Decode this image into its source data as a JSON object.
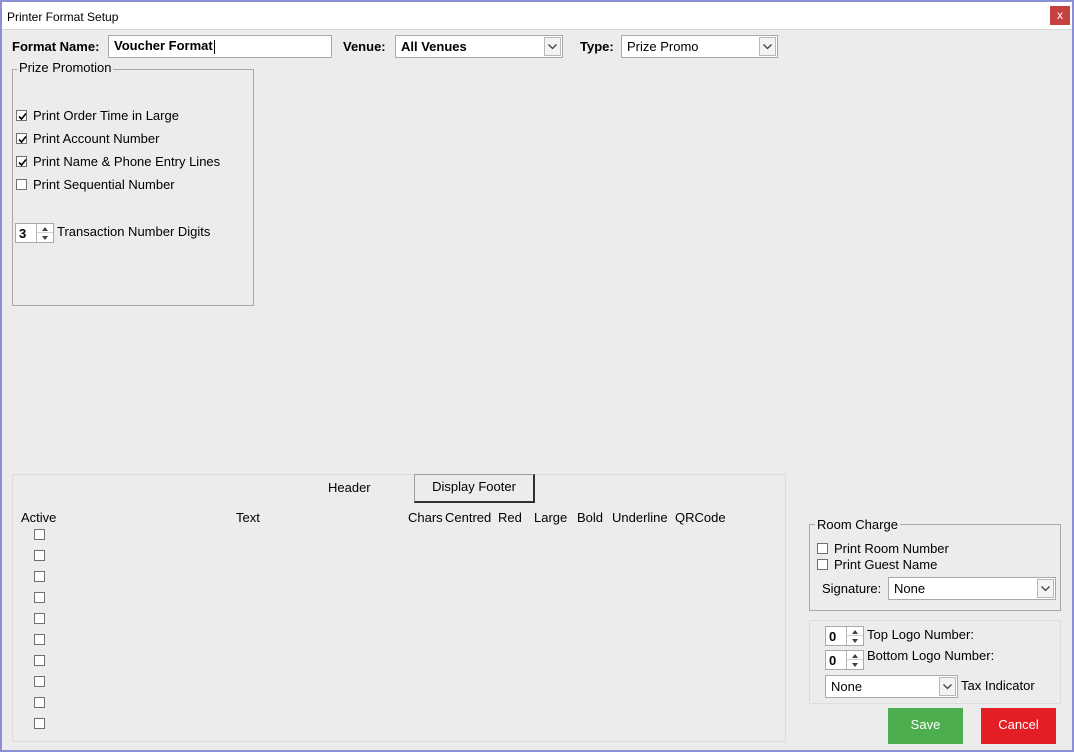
{
  "window": {
    "title": "Printer Format Setup",
    "close_glyph": "x"
  },
  "top_bar": {
    "format_name_label": "Format Name:",
    "format_name_value": "Voucher Format",
    "venue_label": "Venue:",
    "venue_value": "All Venues",
    "type_label": "Type:",
    "type_value": "Prize Promo"
  },
  "prize_promotion": {
    "legend": "Prize Promotion",
    "options": [
      {
        "label": "Print Order Time in Large",
        "checked": true
      },
      {
        "label": "Print Account Number",
        "checked": true
      },
      {
        "label": "Print Name & Phone Entry Lines",
        "checked": true
      },
      {
        "label": "Print Sequential Number",
        "checked": false
      }
    ],
    "transaction_digits_value": "3",
    "transaction_digits_label": "Transaction Number Digits"
  },
  "header_panel": {
    "title": "Header",
    "display_footer_button": "Display Footer",
    "columns": {
      "active": "Active",
      "text": "Text",
      "chars": "Chars",
      "centred": "Centred",
      "red": "Red",
      "large": "Large",
      "bold": "Bold",
      "underline": "Underline",
      "qrcode": "QRCode"
    },
    "row_count": 10
  },
  "room_charge": {
    "legend": "Room Charge",
    "print_room_number": {
      "label": "Print Room Number",
      "checked": false
    },
    "print_guest_name": {
      "label": "Print Guest Name",
      "checked": false
    },
    "signature_label": "Signature:",
    "signature_value": "None"
  },
  "logo_settings": {
    "top_logo_value": "0",
    "top_logo_label": "Top Logo Number:",
    "bottom_logo_value": "0",
    "bottom_logo_label": "Bottom Logo Number:",
    "tax_indicator_value": "None",
    "tax_indicator_label": "Tax Indicator"
  },
  "actions": {
    "save": "Save",
    "cancel": "Cancel"
  },
  "colors": {
    "save": "#4cae4f",
    "cancel": "#e31e24",
    "close": "#c6423f",
    "window_border": "#8a8fd6"
  },
  "icons": {
    "dropdown": "chevron-down-icon",
    "check": "checkmark-icon",
    "spin_up": "spin-up-arrow-icon",
    "spin_down": "spin-down-arrow-icon"
  }
}
